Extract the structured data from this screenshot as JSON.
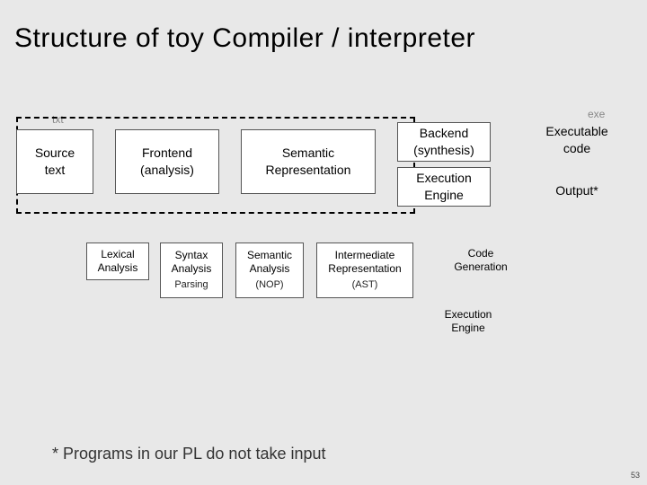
{
  "title": "Structure of toy Compiler / interpreter",
  "captions": {
    "txt": "txt",
    "exe": "exe"
  },
  "top": {
    "source": {
      "l1": "Source",
      "l2": "text"
    },
    "frontend": {
      "l1": "Frontend",
      "l2": "(analysis)"
    },
    "semantic": {
      "l1": "Semantic",
      "l2": "Representation"
    },
    "backend": {
      "l1": "Backend",
      "l2": "(synthesis)"
    },
    "exec": {
      "l1": "Execution",
      "l2": "Engine"
    },
    "execcode": {
      "l1": "Executable",
      "l2": "code"
    },
    "output": {
      "l1": "Output*"
    }
  },
  "mini": {
    "lex": {
      "l1": "Lexical",
      "l2": "Analysis"
    },
    "syn": {
      "l1": "Syntax",
      "l2": "Analysis",
      "sub": "Parsing"
    },
    "sem": {
      "l1": "Semantic",
      "l2": "Analysis",
      "sub": "(NOP)"
    },
    "ir": {
      "l1": "Intermediate",
      "l2": "Representation",
      "sub": "(AST)"
    },
    "code": {
      "l1": "Code",
      "l2": "Generation"
    },
    "exe": {
      "l1": "Execution",
      "l2": "Engine"
    }
  },
  "footnote": "* Programs in our PL do not take input",
  "slidenum": "53"
}
